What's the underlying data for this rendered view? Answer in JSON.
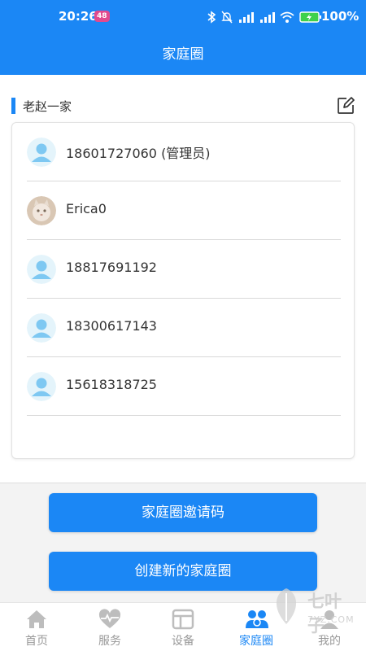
{
  "status_bar": {
    "time": "20:26",
    "badge": "48",
    "battery": "100%",
    "icons": [
      "bluetooth-icon",
      "mute-icon",
      "signal-icon",
      "signal-icon",
      "wifi-icon",
      "battery-icon"
    ]
  },
  "header": {
    "title": "家庭圈"
  },
  "family": {
    "name": "老赵一家",
    "edit_icon": "edit-icon",
    "members": [
      {
        "name": "18601727060 (管理员)",
        "avatar": "default-avatar"
      },
      {
        "name": "Erica0",
        "avatar": "cat-photo-avatar"
      },
      {
        "name": "18817691192",
        "avatar": "default-avatar"
      },
      {
        "name": "18300617143",
        "avatar": "default-avatar"
      },
      {
        "name": "15618318725",
        "avatar": "default-avatar"
      }
    ]
  },
  "buttons": {
    "invite_code": "家庭圈邀请码",
    "create_new": "创建新的家庭圈"
  },
  "tabbar": {
    "active": "家庭圈",
    "items": [
      {
        "label": "首页",
        "icon": "home-icon"
      },
      {
        "label": "服务",
        "icon": "heart-pulse-icon"
      },
      {
        "label": "设备",
        "icon": "device-icon"
      },
      {
        "label": "家庭圈",
        "icon": "family-icon"
      },
      {
        "label": "我的",
        "icon": "user-icon"
      }
    ]
  },
  "watermark": {
    "text": "七叶子",
    "sub": "7YZ.COM"
  },
  "colors": {
    "primary": "#1b87f5",
    "inactive": "#999999"
  }
}
